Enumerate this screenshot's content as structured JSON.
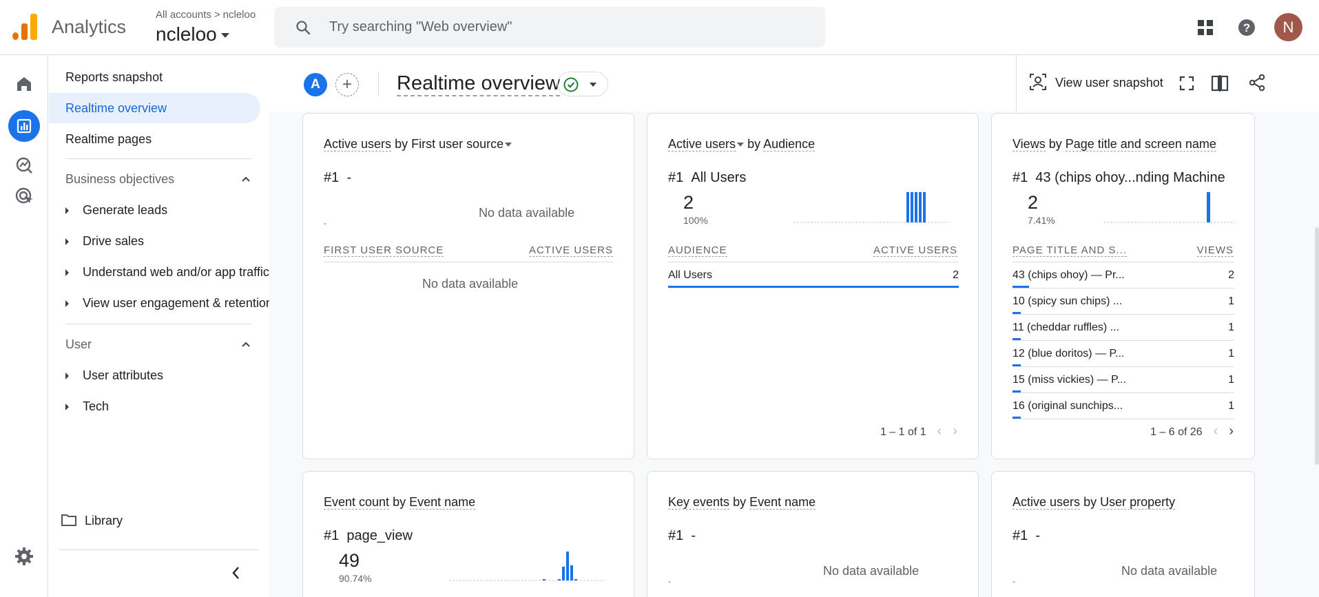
{
  "app": {
    "name": "Analytics"
  },
  "breadcrumb": {
    "root": "All accounts",
    "current": "ncleloo"
  },
  "account": {
    "name": "ncleloo"
  },
  "search": {
    "placeholder": "Try searching \"Web overview\""
  },
  "user": {
    "initial": "N"
  },
  "nav": {
    "reports_snapshot": "Reports snapshot",
    "realtime_overview": "Realtime overview",
    "realtime_pages": "Realtime pages",
    "business_objectives": "Business objectives",
    "bo_items": [
      "Generate leads",
      "Drive sales",
      "Understand web and/or app traffic",
      "View user engagement & retention"
    ],
    "user_section": "User",
    "user_items": [
      "User attributes",
      "Tech"
    ],
    "library": "Library"
  },
  "toolbar": {
    "compare_initial": "A",
    "page_title": "Realtime overview",
    "view_user_snapshot": "View user snapshot"
  },
  "cards": {
    "first_source": {
      "metric": "Active users",
      "by": "by",
      "dimension": "First user source",
      "rank": "#1",
      "rank_value": "-",
      "no_data_chart": "No data available",
      "col1": "FIRST USER SOURCE",
      "col2": "ACTIVE USERS",
      "no_data_table": "No data available",
      "dash": "-"
    },
    "audience": {
      "metric": "Active users",
      "by": "by",
      "dimension": "Audience",
      "rank": "#1",
      "rank_value": "All Users",
      "value": "2",
      "pct": "100%",
      "col1": "AUDIENCE",
      "col2": "ACTIVE USERS",
      "rows": [
        {
          "label": "All Users",
          "value": "2",
          "share": 1.0
        }
      ],
      "pager": "1 – 1 of 1"
    },
    "views": {
      "metric": "Views",
      "by": "by",
      "dimension": "Page title and screen name",
      "rank": "#1",
      "rank_value": "43 (chips ohoy...nding Machine",
      "value": "2",
      "pct": "7.41%",
      "col1": "PAGE TITLE AND S...",
      "col2": "VIEWS",
      "rows": [
        {
          "label": "43 (chips ohoy) — Pr...",
          "value": "2",
          "share": 0.0741
        },
        {
          "label": "10 (spicy sun chips) ...",
          "value": "1",
          "share": 0.037
        },
        {
          "label": "11 (cheddar ruffles) ...",
          "value": "1",
          "share": 0.037
        },
        {
          "label": "12 (blue doritos) — P...",
          "value": "1",
          "share": 0.037
        },
        {
          "label": "15 (miss vickies) — P...",
          "value": "1",
          "share": 0.037
        },
        {
          "label": "16 (original sunchips...",
          "value": "1",
          "share": 0.037
        }
      ],
      "pager": "1 – 6 of 26"
    },
    "events": {
      "metric": "Event count",
      "by": "by",
      "dimension": "Event name",
      "rank": "#1",
      "rank_value": "page_view",
      "value": "49",
      "pct": "90.74%"
    },
    "key_events": {
      "metric": "Key events",
      "by": "by",
      "dimension": "Event name",
      "rank": "#1",
      "rank_value": "-",
      "no_data_chart": "No data available",
      "dash": "-"
    },
    "user_property": {
      "metric": "Active users",
      "by": "by",
      "dimension": "User property",
      "rank": "#1",
      "rank_value": "-",
      "no_data_chart": "No data available",
      "dash": "-"
    }
  },
  "colors": {
    "accent": "#1a73e8",
    "active_nav_bg": "#e8f0fe",
    "success": "#188038"
  }
}
